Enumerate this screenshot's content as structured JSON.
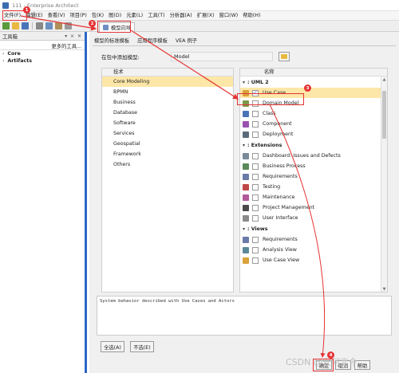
{
  "window": {
    "title": "111 - Enterprise Architect"
  },
  "menu": [
    "文件(F)",
    "编辑(E)",
    "查看(V)",
    "项目(P)",
    "包(K)",
    "图(D)",
    "元素(L)",
    "工具(T)",
    "分析器(A)",
    "扩展(X)",
    "窗口(W)",
    "帮助(H)"
  ],
  "toolbar_tab": {
    "label": "模型向导"
  },
  "toolbox": {
    "title": "工具箱",
    "header_icons": "▾ ⨯ ✕",
    "more": "更多的工具...",
    "groups": [
      {
        "label": "Core"
      },
      {
        "label": "Artifacts"
      }
    ]
  },
  "wizard": {
    "tabs": [
      "模型的标准模板",
      "应用程序模板",
      "VEA 例子"
    ],
    "add_label": "在包中添加模型:",
    "add_value": "Model",
    "tech_header": "技术",
    "technologies": [
      "Core Modeling",
      "BPMN",
      "Business",
      "Database",
      "Software",
      "Services",
      "Geospatial",
      "Framework",
      "Others"
    ],
    "name_header": "名称",
    "groups": [
      {
        "label": ": UML 2",
        "items": [
          {
            "label": "Use Case",
            "checked": true
          },
          {
            "label": "Domain Model",
            "checked": false
          },
          {
            "label": "Class",
            "checked": false
          },
          {
            "label": "Component",
            "checked": false
          },
          {
            "label": "Deployment",
            "checked": false
          }
        ]
      },
      {
        "label": ": Extensions",
        "items": [
          {
            "label": "Dashboard: Issues and Defects",
            "checked": false
          },
          {
            "label": "Business Process",
            "checked": false
          },
          {
            "label": "Requirements",
            "checked": false
          },
          {
            "label": "Testing",
            "checked": false
          },
          {
            "label": "Maintenance",
            "checked": false
          },
          {
            "label": "Project Management",
            "checked": false
          },
          {
            "label": "User Interface",
            "checked": false
          }
        ]
      },
      {
        "label": ": Views",
        "items": [
          {
            "label": "Requirements",
            "checked": false
          },
          {
            "label": "Analysis View",
            "checked": false
          },
          {
            "label": "Use Case View",
            "checked": false
          }
        ]
      }
    ],
    "description": "System behavior described with Use Cases and Actors",
    "buttons": {
      "select_all": "全选(A)",
      "select_none": "不选(E)",
      "ok": "确定",
      "cancel": "取消",
      "help": "帮助"
    }
  },
  "annotations": [
    "1",
    "2",
    "3",
    "4"
  ],
  "watermark": "CSDN @安何言今"
}
